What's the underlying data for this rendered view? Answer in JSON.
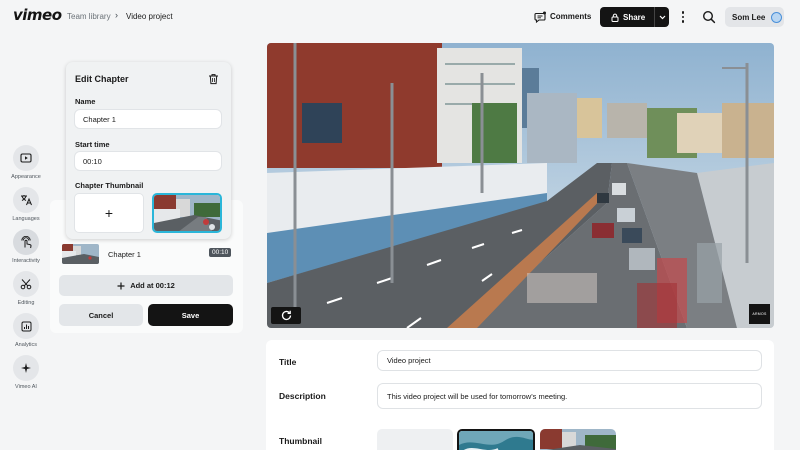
{
  "header": {
    "logo": "vimeo",
    "breadcrumb": [
      "Team library",
      "Video project"
    ],
    "breadcrumb_sep": "›",
    "comments_label": "Comments",
    "share_label": "Share",
    "user_name": "Som Lee"
  },
  "sidebar": {
    "items": [
      {
        "label": "Appearance",
        "icon": "appearance-icon"
      },
      {
        "label": "Languages",
        "icon": "languages-icon"
      },
      {
        "label": "Interactivity",
        "icon": "interactivity-icon",
        "active": true
      },
      {
        "label": "Editing",
        "icon": "scissors-icon"
      },
      {
        "label": "Analytics",
        "icon": "analytics-icon"
      },
      {
        "label": "Vimeo AI",
        "icon": "sparkle-icon"
      }
    ]
  },
  "edit_chapter": {
    "title": "Edit Chapter",
    "name_label": "Name",
    "name_value": "Chapter 1",
    "start_label": "Start time",
    "start_value": "00:10",
    "thumb_label": "Chapter Thumbnail",
    "add_symbol": "+"
  },
  "chapters": [
    {
      "name": "Chapter 1",
      "time": "00:10"
    }
  ],
  "actions": {
    "add_at": "Add at 00:12",
    "cancel": "Cancel",
    "save": "Save"
  },
  "video": {
    "brand_mark": "ARMOS"
  },
  "details": {
    "title_label": "Title",
    "title_value": "Video project",
    "description_label": "Description",
    "description_value": "This video project will be used for tomorrow's meeting.",
    "thumbnail_label": "Thumbnail"
  },
  "colors": {
    "accent": "#2ab6d9",
    "dark": "#141414",
    "background": "#f4f5f6"
  }
}
